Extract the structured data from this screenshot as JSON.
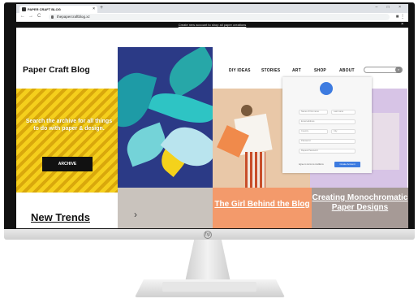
{
  "browser": {
    "tab_title": "PAPER CRAFT BLOG",
    "tab_close": "×",
    "new_tab": "+",
    "url": "thepapercraftblog.xz",
    "window_controls": "– □ ×",
    "nav": {
      "back": "←",
      "forward": "→",
      "reload": "C"
    },
    "extensions": "■ ⋮"
  },
  "promo": {
    "text": "Create new account to shop all paper creations",
    "close": "×"
  },
  "site": {
    "logo": "Paper Craft Blog",
    "nav": [
      "DIY IDEAS",
      "STORIES",
      "ART",
      "SHOP",
      "ABOUT"
    ],
    "search_icon": "⌕"
  },
  "hero": {
    "search_text": "Search the archive for all things to do with paper & design.",
    "archive_button": "ARCHIVE"
  },
  "cards": {
    "girl_title": "The Girl Behind the Blog",
    "creating_title": "Creating Monochromatic Paper Designs",
    "trends_title": "New Trends",
    "arrow": "›"
  },
  "form": {
    "fields": [
      "Name of first name",
      "Last name",
      "Email address",
      "Country",
      "City",
      "Password",
      "Repeat Password"
    ],
    "footer": "Agree to terms & conditions",
    "submit": "Create Account"
  },
  "monitor": {
    "brand": "hp"
  }
}
